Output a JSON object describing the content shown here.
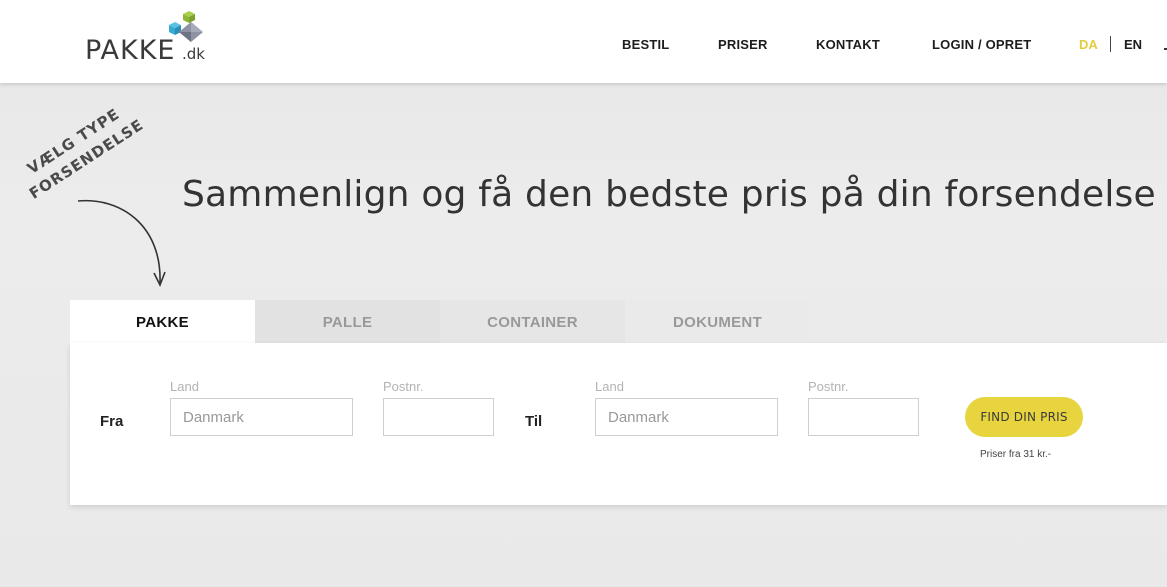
{
  "header": {
    "logo": {
      "main": "PAKKE",
      "tld": ".dk"
    },
    "nav": [
      {
        "label": "BESTIL"
      },
      {
        "label": "PRISER"
      },
      {
        "label": "KONTAKT"
      },
      {
        "label": "LOGIN / OPRET"
      }
    ],
    "lang": {
      "active": "DA",
      "other": "EN"
    },
    "colors": {
      "accent": "#e6cc3c"
    }
  },
  "hint": {
    "line1": "VÆLG TYPE",
    "line2": "FORSENDELSE"
  },
  "headline": "Sammenlign og få den bedste pris på din forsendelse",
  "tabs": [
    {
      "label": "PAKKE",
      "active": true
    },
    {
      "label": "PALLE",
      "active": false
    },
    {
      "label": "CONTAINER",
      "active": false
    },
    {
      "label": "DOKUMENT",
      "active": false
    }
  ],
  "form": {
    "from": {
      "label": "Fra",
      "country_label": "Land",
      "country_value": "Danmark",
      "zip_label": "Postnr.",
      "zip_value": ""
    },
    "to": {
      "label": "Til",
      "country_label": "Land",
      "country_value": "Danmark",
      "zip_label": "Postnr.",
      "zip_value": ""
    },
    "submit_label": "FIND DIN PRIS",
    "price_note": "Priser fra 31 kr.-",
    "button_color": "#e8d43f"
  }
}
